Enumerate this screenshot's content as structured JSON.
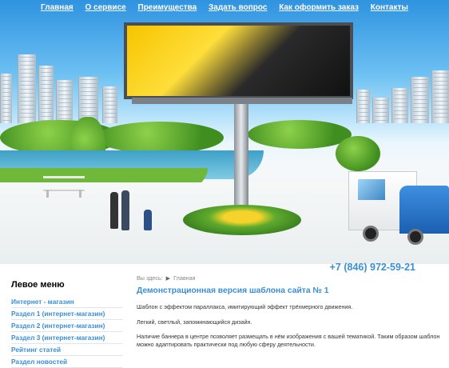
{
  "nav": [
    {
      "label": "Главная"
    },
    {
      "label": "О сервисе"
    },
    {
      "label": "Преимущества"
    },
    {
      "label": "Задать вопрос"
    },
    {
      "label": "Как оформить заказ"
    },
    {
      "label": "Контакты"
    }
  ],
  "header": {
    "phone": "+7 (846) 972-59-21"
  },
  "sidebar": {
    "title": "Левое меню",
    "items": [
      {
        "label": "Интернет - магазин"
      },
      {
        "label": "Раздел 1 (интернет-магазин)"
      },
      {
        "label": "Раздел 2 (интернет-магазин)"
      },
      {
        "label": "Раздел 3 (интернет-магазин)"
      },
      {
        "label": "Рейтинг статей"
      },
      {
        "label": "Раздел новостей"
      }
    ]
  },
  "content": {
    "breadcrumb": {
      "prefix": "Вы здесь:",
      "current": "Главная"
    },
    "title": "Демонстрационная версия шаблона сайта № 1",
    "paragraphs": [
      "Шаблон с эффектом параллакса, имитирующий эффект трёхмерного движения.",
      "Легкий, светлый, запоминающийся дизайн.",
      "Наличие баннера в центре позволяет размещать в нём изображения с вашей тематикой. Таким образом шаблон можно адаптировать практически под любую сферу деятельности."
    ]
  },
  "colors": {
    "accent": "#3a8fd6",
    "sky": "#2f93e0",
    "billboard": "#f6c400",
    "truck": "#1b5fb1"
  }
}
